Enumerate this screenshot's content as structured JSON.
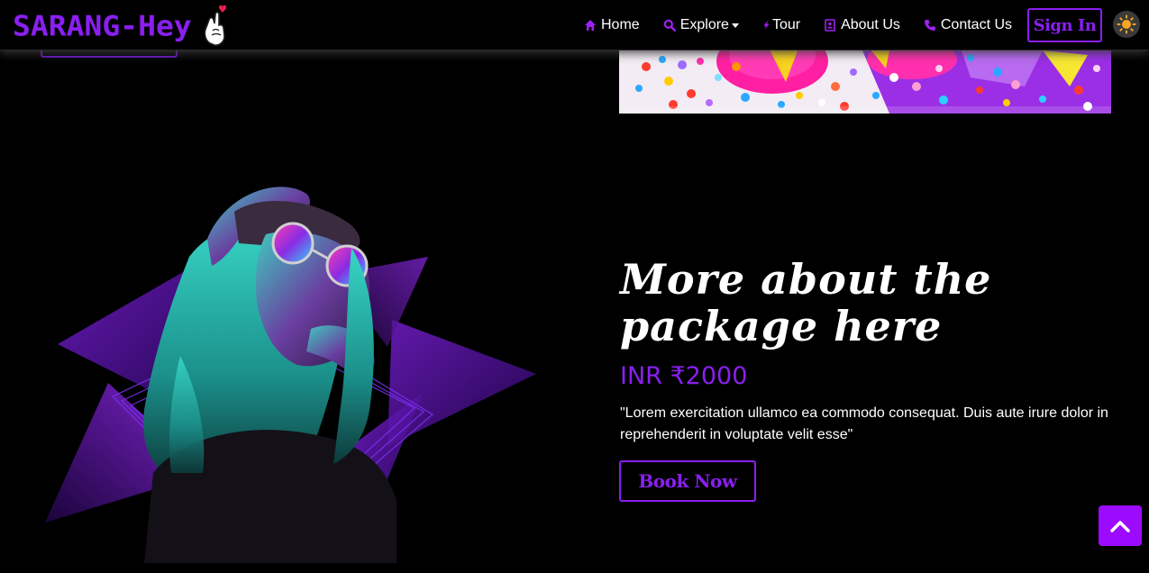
{
  "brand": {
    "name": "SARANG-Hey",
    "logo_icon": "finger-heart-icon"
  },
  "nav": {
    "items": [
      {
        "label": "Home",
        "icon": "home-icon"
      },
      {
        "label": "Explore",
        "icon": "search-icon",
        "dropdown": true
      },
      {
        "label": "Tour",
        "icon": "bolt-icon"
      },
      {
        "label": "About Us",
        "icon": "contact-card-icon"
      },
      {
        "label": "Contact Us",
        "icon": "phone-icon"
      }
    ],
    "signin_label": "Sign In",
    "theme_icon": "sun-icon"
  },
  "package": {
    "title": "More about the package here",
    "price": "INR ₹2000",
    "description": "\"Lorem exercitation ullamco ea commodo consequat. Duis aute irure dolor in reprehenderit in voluptate velit esse\"",
    "book_label": "Book Now"
  },
  "scroll_top_icon": "chevron-up-icon",
  "colors": {
    "accent": "#8a1ff0",
    "background": "#000000",
    "scroll_button": "#9d0bff"
  }
}
